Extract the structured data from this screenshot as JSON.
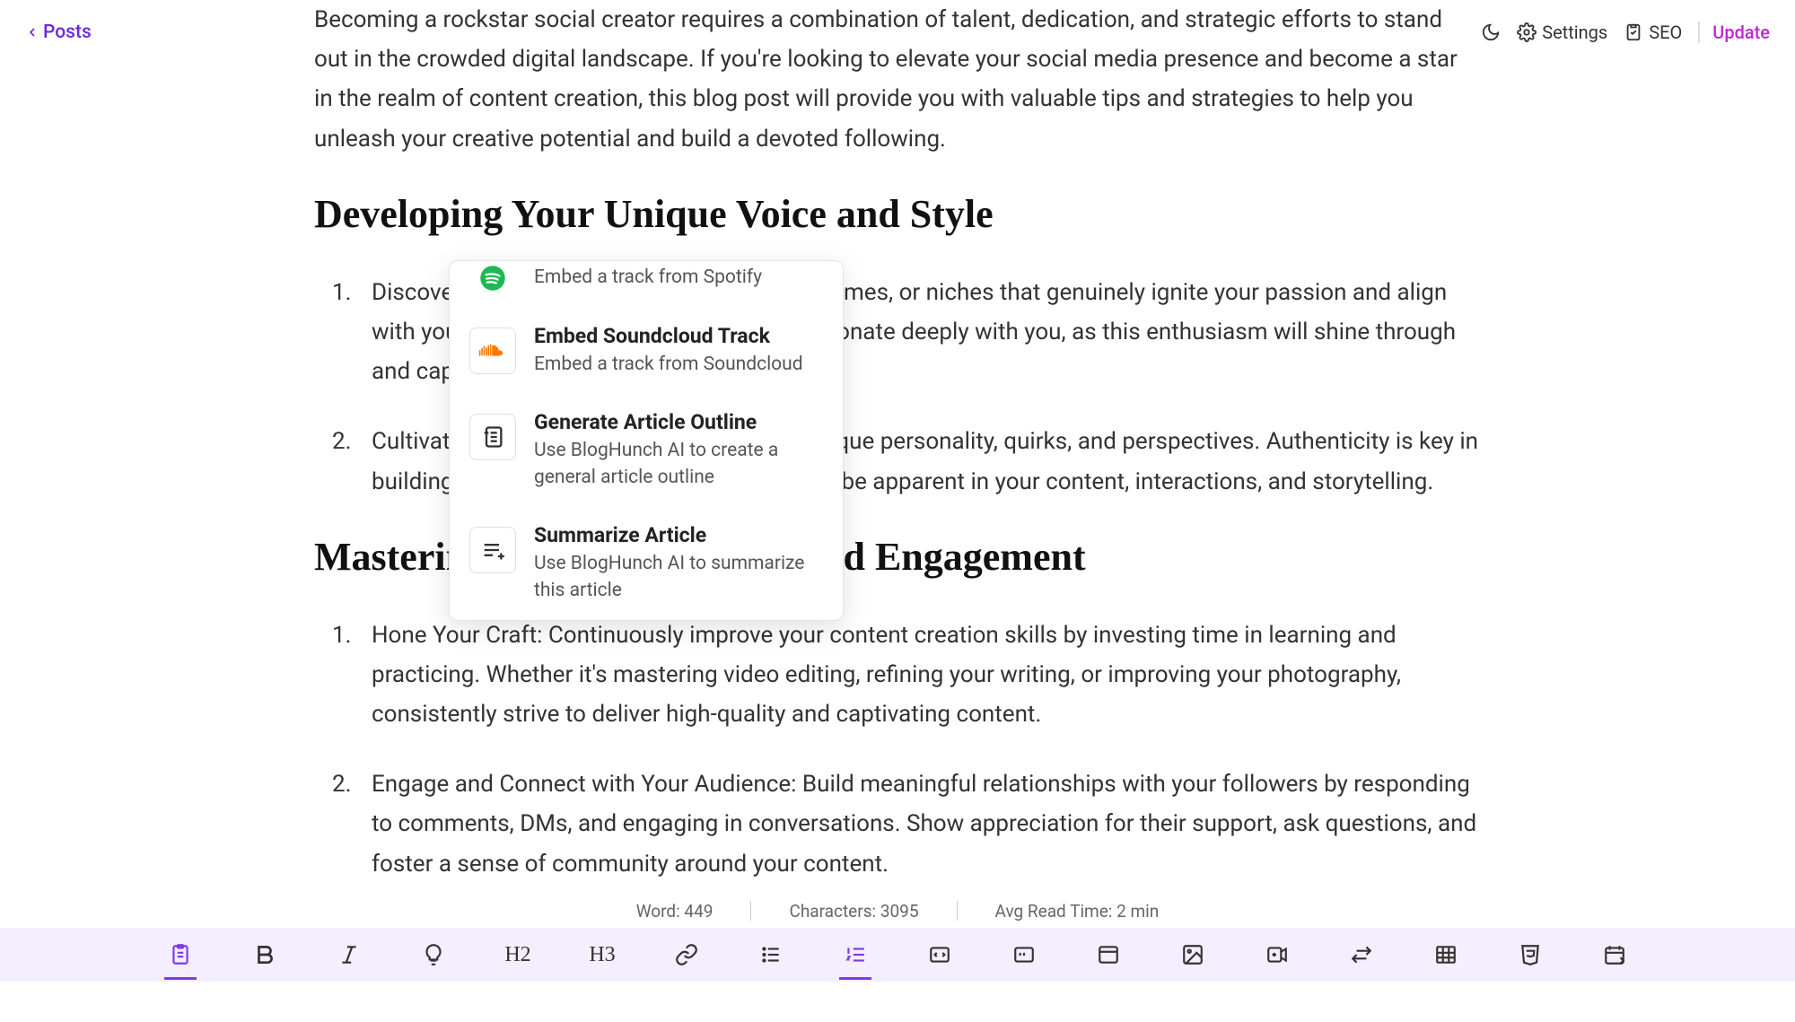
{
  "topbar": {
    "back_label": "Posts",
    "settings_label": "Settings",
    "seo_label": "SEO",
    "update_label": "Update"
  },
  "content": {
    "intro": "Becoming a rockstar social creator requires a combination of talent, dedication, and strategic efforts to stand out in the crowded digital landscape. If you're looking to elevate your social media presence and become a star in the realm of content creation, this blog post will provide you with valuable tips and strategies to help you unleash your creative potential and build a devoted following.",
    "h2_1": "Developing Your Unique Voice and Style",
    "ol1": [
      "Discover Your Passion: Identify the topics, themes, or niches that genuinely ignite your passion and align with your expertise. Choose subjects that resonate deeply with you, as this enthusiasm will shine through and captivate your audience.",
      "Cultivate Your Authenticity: Embrace your unique personality, quirks, and perspectives. Authenticity is key in building a loyal following, so let your true self be apparent in your content, interactions, and storytelling."
    ],
    "h2_2": "Mastering Content Creation and Engagement",
    "ol2": [
      "Hone Your Craft: Continuously improve your content creation skills by investing time in learning and practicing. Whether it's mastering video editing, refining your writing, or improving your photography, consistently strive to deliver high-quality and captivating content.",
      "Engage and Connect with Your Audience: Build meaningful relationships with your followers by responding to comments, DMs, and engaging in conversations. Show appreciation for their support, ask questions, and foster a sense of community around your content."
    ]
  },
  "dropdown": {
    "items": [
      {
        "title": "",
        "desc": "Embed a track from Spotify"
      },
      {
        "title": "Embed Soundcloud Track",
        "desc": "Embed a track from Soundcloud"
      },
      {
        "title": "Generate Article Outline",
        "desc": "Use BlogHunch AI to create a general article outline"
      },
      {
        "title": "Summarize Article",
        "desc": "Use BlogHunch AI to summarize this article"
      }
    ]
  },
  "stats": {
    "words": "Word: 449",
    "chars": "Characters: 3095",
    "read": "Avg Read Time: 2 min"
  },
  "toolbar": {
    "h2": "H2",
    "h3": "H3"
  }
}
